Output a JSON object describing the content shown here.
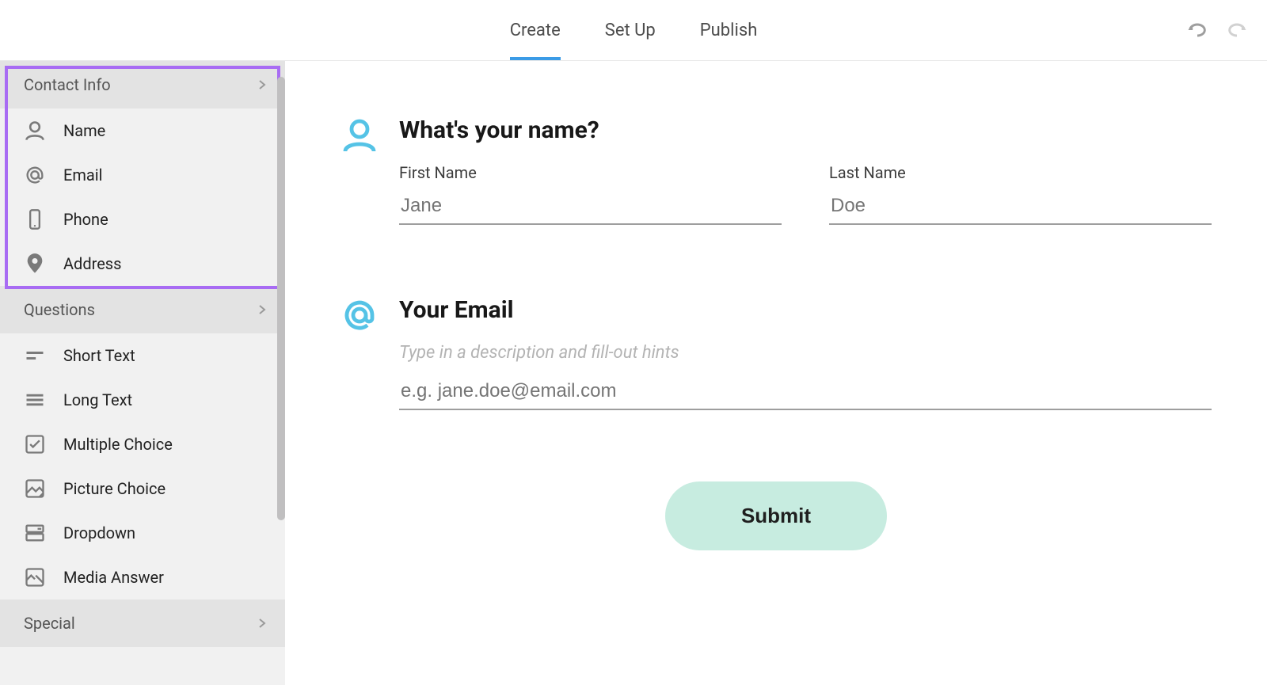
{
  "header": {
    "tabs": [
      {
        "label": "Create",
        "active": true
      },
      {
        "label": "Set Up",
        "active": false
      },
      {
        "label": "Publish",
        "active": false
      }
    ]
  },
  "sidebar": {
    "sections": [
      {
        "title": "Contact Info",
        "highlighted": true,
        "items": [
          {
            "label": "Name",
            "icon": "person-icon"
          },
          {
            "label": "Email",
            "icon": "at-icon"
          },
          {
            "label": "Phone",
            "icon": "phone-icon"
          },
          {
            "label": "Address",
            "icon": "pin-icon"
          }
        ]
      },
      {
        "title": "Questions",
        "items": [
          {
            "label": "Short Text",
            "icon": "short-text-icon"
          },
          {
            "label": "Long Text",
            "icon": "long-text-icon"
          },
          {
            "label": "Multiple Choice",
            "icon": "checkbox-icon"
          },
          {
            "label": "Picture Choice",
            "icon": "image-icon"
          },
          {
            "label": "Dropdown",
            "icon": "dropdown-icon"
          },
          {
            "label": "Media Answer",
            "icon": "media-icon"
          }
        ]
      },
      {
        "title": "Special",
        "items": []
      }
    ]
  },
  "form": {
    "name_question": {
      "title": "What's your name?",
      "first_name_label": "First Name",
      "first_name_placeholder": "Jane",
      "last_name_label": "Last Name",
      "last_name_placeholder": "Doe"
    },
    "email_question": {
      "title": "Your Email",
      "description_placeholder": "Type in a description and fill-out hints",
      "email_placeholder": "e.g. jane.doe@email.com"
    },
    "submit_label": "Submit"
  },
  "colors": {
    "accent_tab": "#3b9be6",
    "question_icon": "#55c3e6",
    "submit_bg": "#c7ece0",
    "highlight_border": "#a86cf3"
  }
}
